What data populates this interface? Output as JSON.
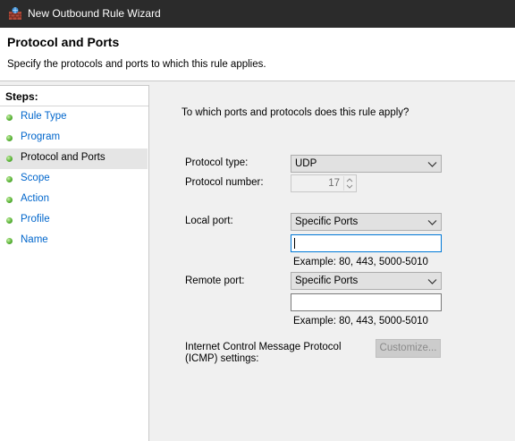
{
  "window": {
    "title": "New Outbound Rule Wizard",
    "icon": "firewall-wizard-icon"
  },
  "header": {
    "title": "Protocol and Ports",
    "subtitle": "Specify the protocols and ports to which this rule applies."
  },
  "steps": {
    "title": "Steps:",
    "items": [
      {
        "label": "Rule Type",
        "active": false
      },
      {
        "label": "Program",
        "active": false
      },
      {
        "label": "Protocol and Ports",
        "active": true
      },
      {
        "label": "Scope",
        "active": false
      },
      {
        "label": "Action",
        "active": false
      },
      {
        "label": "Profile",
        "active": false
      },
      {
        "label": "Name",
        "active": false
      }
    ]
  },
  "form": {
    "question": "To which ports and protocols does this rule apply?",
    "protocol_type_label": "Protocol type:",
    "protocol_type_value": "UDP",
    "protocol_number_label": "Protocol number:",
    "protocol_number_value": "17",
    "local_port_label": "Local port:",
    "local_port_value": "Specific Ports",
    "local_port_input": "",
    "local_port_example": "Example: 80, 443, 5000-5010",
    "remote_port_label": "Remote port:",
    "remote_port_value": "Specific Ports",
    "remote_port_input": "",
    "remote_port_example": "Example: 80, 443, 5000-5010",
    "icmp_label_line1": "Internet Control Message Protocol",
    "icmp_label_line2": "(ICMP) settings:",
    "customize_label": "Customize..."
  },
  "colors": {
    "titlebar": "#2b2b2b",
    "link": "#0066cc",
    "focus": "#0078d7",
    "step_dot": "#5bb338"
  }
}
